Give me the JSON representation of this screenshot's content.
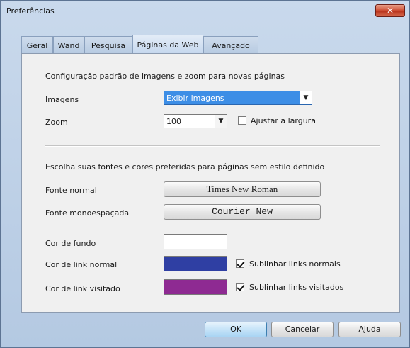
{
  "window": {
    "title": "Preferências",
    "close_label": "✕"
  },
  "tabs": [
    {
      "label": "Geral"
    },
    {
      "label": "Wand"
    },
    {
      "label": "Pesquisa"
    },
    {
      "label": "Páginas da Web",
      "active": true
    },
    {
      "label": "Avançado"
    }
  ],
  "images_section": {
    "heading": "Configuração padrão de imagens e zoom para novas páginas",
    "images_label": "Imagens",
    "images_value": "Exibir imagens",
    "zoom_label": "Zoom",
    "zoom_value": "100",
    "fit_width_label": "Ajustar a largura",
    "fit_width_checked": false
  },
  "fonts_section": {
    "heading": "Escolha suas fontes e cores preferidas para páginas sem estilo definido",
    "normal_font_label": "Fonte normal",
    "normal_font_value": "Times New Roman",
    "mono_font_label": "Fonte monoespaçada",
    "mono_font_value": "Courier New",
    "bg_color_label": "Cor de fundo",
    "bg_color": "#ffffff",
    "link_color_label": "Cor de link normal",
    "link_color": "#2f3fa3",
    "underline_links_label": "Sublinhar links normais",
    "underline_links_checked": true,
    "visited_color_label": "Cor de link visitado",
    "visited_color": "#8e2a92",
    "underline_visited_label": "Sublinhar links visitados",
    "underline_visited_checked": true
  },
  "footer": {
    "ok_label": "OK",
    "cancel_label": "Cancelar",
    "help_label": "Ajuda"
  }
}
